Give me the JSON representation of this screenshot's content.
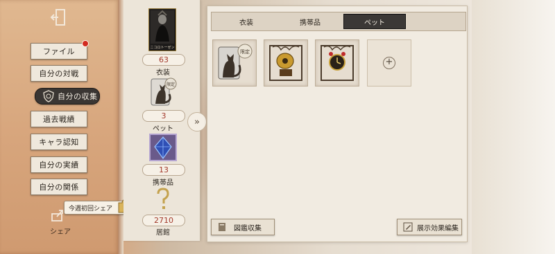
{
  "sidebar": {
    "items": [
      {
        "label": "ファイル"
      },
      {
        "label": "自分の対戦"
      },
      {
        "label": "自分の収集"
      },
      {
        "label": "過去戦績"
      },
      {
        "label": "キャラ認知"
      },
      {
        "label": "自分の実績"
      },
      {
        "label": "自分の関係"
      }
    ],
    "active_index": 2,
    "share_label": "シェア",
    "share_tip": "今週初回シェア"
  },
  "stats": [
    {
      "count": "63",
      "label": "衣装"
    },
    {
      "count": "3",
      "label": "ペット"
    },
    {
      "count": "13",
      "label": "携帯品"
    },
    {
      "count": "2710",
      "label": "居館"
    }
  ],
  "costume_card_caption": "ニコロトーゼン",
  "limited_badge": "限定",
  "tabs": [
    {
      "label": "衣装"
    },
    {
      "label": "携帯品"
    },
    {
      "label": "ペット"
    }
  ],
  "active_tab": 2,
  "expand_icon": "»",
  "add_icon": "+",
  "buttons": {
    "gallery": "図鑑収集",
    "display_edit": "展示効果編集"
  },
  "colors": {
    "accent_dark": "#3b3836",
    "count_red": "#a33a2c",
    "notification": "#d22a1f"
  }
}
